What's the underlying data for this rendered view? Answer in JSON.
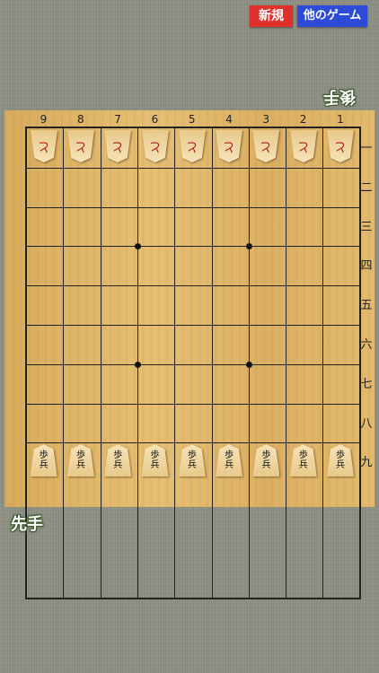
{
  "buttons": {
    "new_game": "新規",
    "other_games": "他のゲーム"
  },
  "players": {
    "gote": "後手",
    "sente": "先手"
  },
  "board": {
    "columns": [
      "9",
      "8",
      "7",
      "6",
      "5",
      "4",
      "3",
      "2",
      "1"
    ],
    "rows": [
      "一",
      "二",
      "三",
      "四",
      "五",
      "六",
      "七",
      "八",
      "九"
    ]
  },
  "pieces": {
    "gote_top_row": {
      "kanji": "と",
      "count": 9
    },
    "sente_bottom_row": {
      "kanji_top": "歩",
      "kanji_bottom": "兵",
      "count": 9
    }
  },
  "colors": {
    "new_button": "#e0302b",
    "other_button": "#2d4bd8",
    "board": "#dfb466",
    "tatami": "#8f9184"
  }
}
